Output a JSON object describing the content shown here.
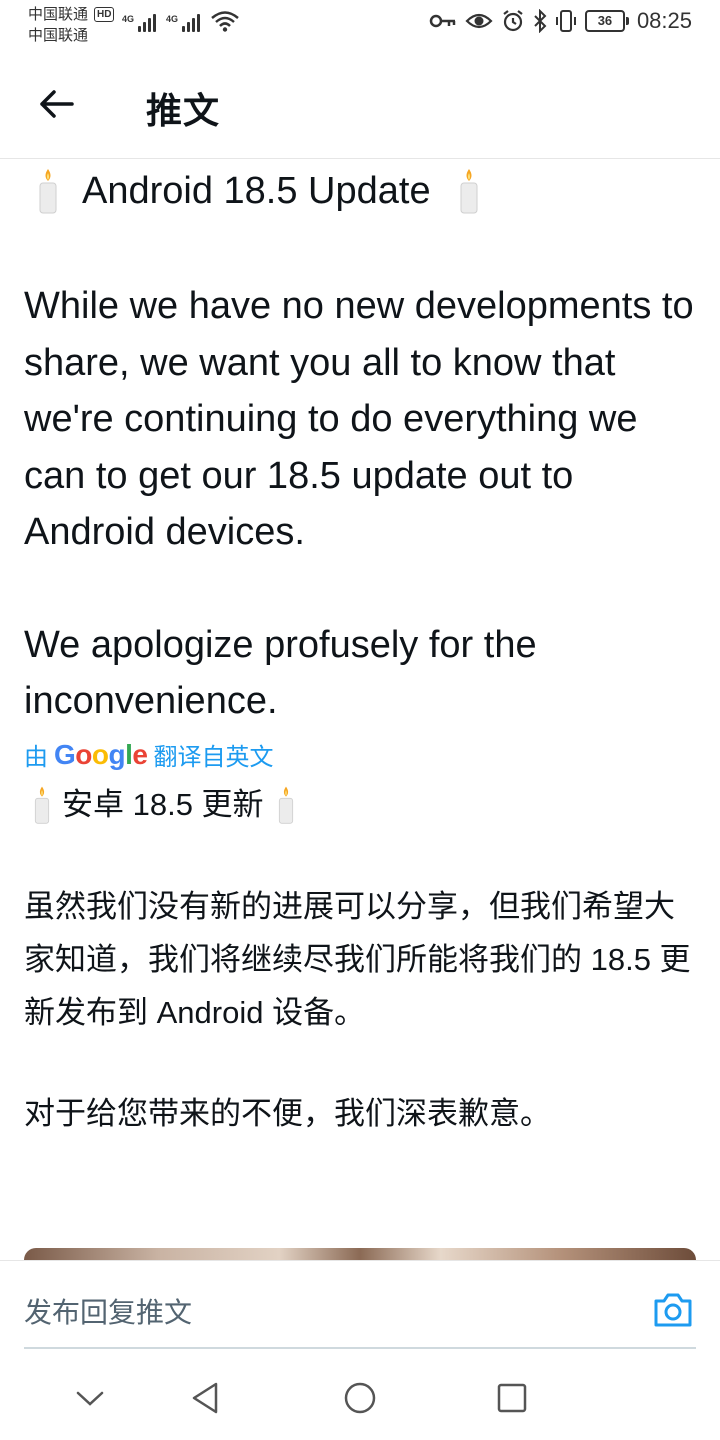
{
  "status_bar": {
    "carrier_1": "中国联通",
    "carrier_hd": "HD",
    "carrier_2": "中国联通",
    "signal_tag_1": "4G",
    "signal_tag_2": "4G",
    "battery": "36",
    "time": "08:25",
    "icons": [
      "key-icon",
      "eye-icon",
      "alarm-icon",
      "bluetooth-icon",
      "vibrate-icon",
      "battery-icon",
      "wifi-icon"
    ]
  },
  "header": {
    "title": "推文",
    "back_icon": "arrow-left-icon"
  },
  "tweet": {
    "title": "Android 18.5 Update",
    "paragraph_1": "While we have no new developments to share, we want you all to know that we're continuing to do everything we can to get our 18.5 update out to Android devices.",
    "paragraph_2": "We apologize profusely for the inconvenience.",
    "title_emoji": "candle-icon"
  },
  "translation": {
    "prefix": "由",
    "brand": "Google",
    "suffix": "翻译自英文",
    "title": "安卓 18.5 更新",
    "paragraph_1": "虽然我们没有新的进展可以分享，但我们希望大家知道，我们将继续尽我们所能将我们的 18.5 更新发布到 Android 设备。",
    "paragraph_2": "对于给您带来的不便，我们深表歉意。"
  },
  "reply": {
    "placeholder": "发布回复推文",
    "camera_icon": "camera-icon"
  },
  "nav": {
    "icons": [
      "chevron-down-icon",
      "back-triangle-icon",
      "home-circle-icon",
      "recents-square-icon"
    ]
  },
  "colors": {
    "text": "#0f1419",
    "accent": "#1d9bf0",
    "muted": "#536471"
  }
}
